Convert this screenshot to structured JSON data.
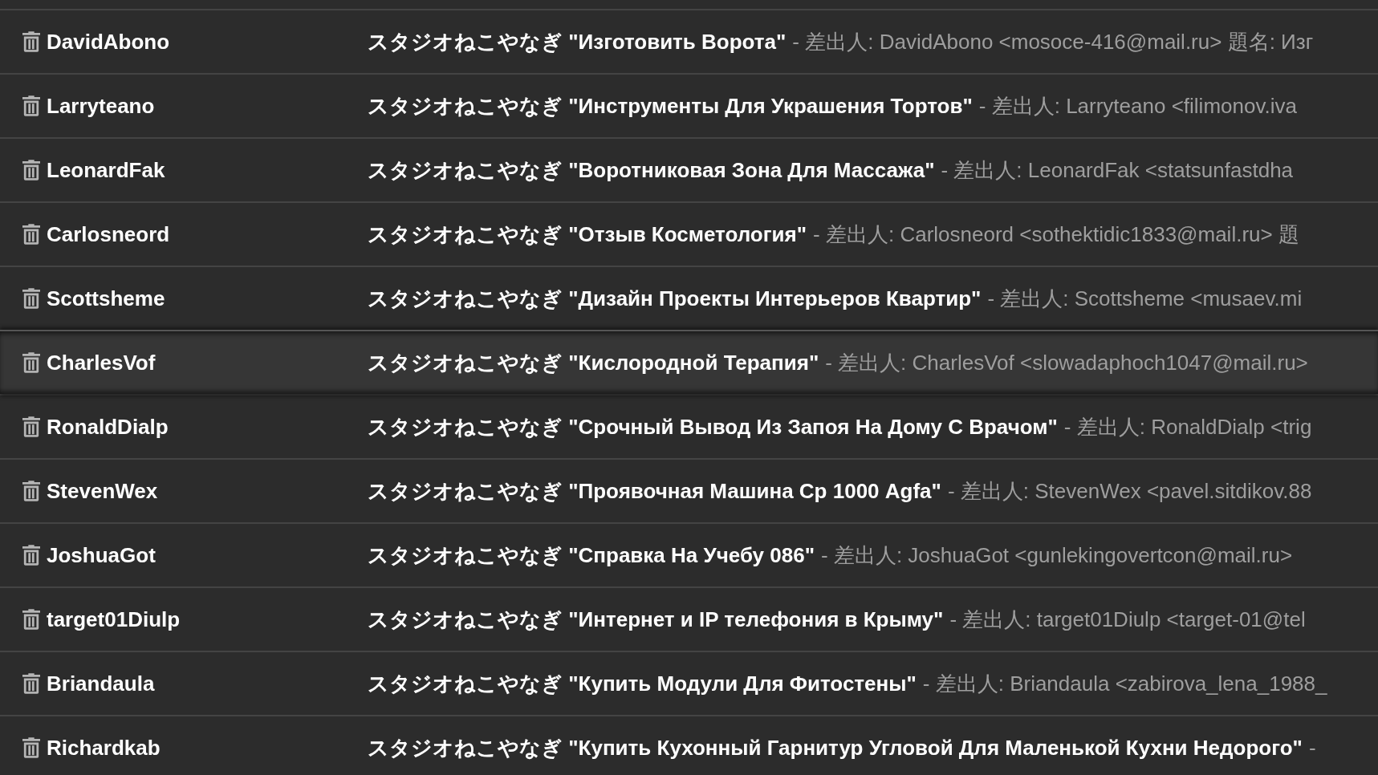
{
  "messages": [
    {
      "sender": "DavidAbono",
      "subject": "スタジオねこやなぎ \"Изготовить Ворота\"",
      "snippet": "- 差出人: DavidAbono <mosoce-416@mail.ru> 題名: Изг",
      "hovered": false
    },
    {
      "sender": "Larryteano",
      "subject": "スタジオねこやなぎ \"Инструменты Для Украшения Тортов\"",
      "snippet": "- 差出人: Larryteano <filimonov.iva",
      "hovered": false
    },
    {
      "sender": "LeonardFak",
      "subject": "スタジオねこやなぎ \"Воротниковая Зона Для Массажа\"",
      "snippet": "- 差出人: LeonardFak <statsunfastdha",
      "hovered": false
    },
    {
      "sender": "Carlosneord",
      "subject": "スタジオねこやなぎ \"Отзыв Косметология\"",
      "snippet": "- 差出人: Carlosneord <sothektidic1833@mail.ru> 題",
      "hovered": false
    },
    {
      "sender": "Scottsheme",
      "subject": "スタジオねこやなぎ \"Дизайн Проекты Интерьеров Квартир\"",
      "snippet": "- 差出人: Scottsheme <musaev.mi",
      "hovered": false
    },
    {
      "sender": "CharlesVof",
      "subject": "スタジオねこやなぎ \"Кислородной Терапия\"",
      "snippet": "- 差出人: CharlesVof <slowadaphoch1047@mail.ru>",
      "hovered": true
    },
    {
      "sender": "RonaldDialp",
      "subject": "スタジオねこやなぎ \"Срочный Вывод Из Запоя На Дому С Врачом\"",
      "snippet": "- 差出人: RonaldDialp <trig",
      "hovered": false
    },
    {
      "sender": "StevenWex",
      "subject": "スタジオねこやなぎ \"Проявочная Машина Ср 1000 Agfa\"",
      "snippet": "- 差出人: StevenWex <pavel.sitdikov.88",
      "hovered": false
    },
    {
      "sender": "JoshuaGot",
      "subject": "スタジオねこやなぎ \"Справка На Учебу 086\"",
      "snippet": "- 差出人: JoshuaGot <gunlekingovertcon@mail.ru>",
      "hovered": false
    },
    {
      "sender": "target01Diulp",
      "subject": "スタジオねこやなぎ \"Интернет и IP телефония в Крыму\"",
      "snippet": "- 差出人: target01Diulp <target-01@tel",
      "hovered": false
    },
    {
      "sender": "Briandaula",
      "subject": "スタジオねこやなぎ \"Купить Модули Для Фитостены\"",
      "snippet": "- 差出人: Briandaula <zabirova_lena_1988_",
      "hovered": false
    },
    {
      "sender": "Richardkab",
      "subject": "スタジオねこやなぎ \"Купить Кухонный Гарнитур Угловой Для Маленькой Кухни Недорого\"",
      "snippet": "-",
      "hovered": false
    }
  ]
}
